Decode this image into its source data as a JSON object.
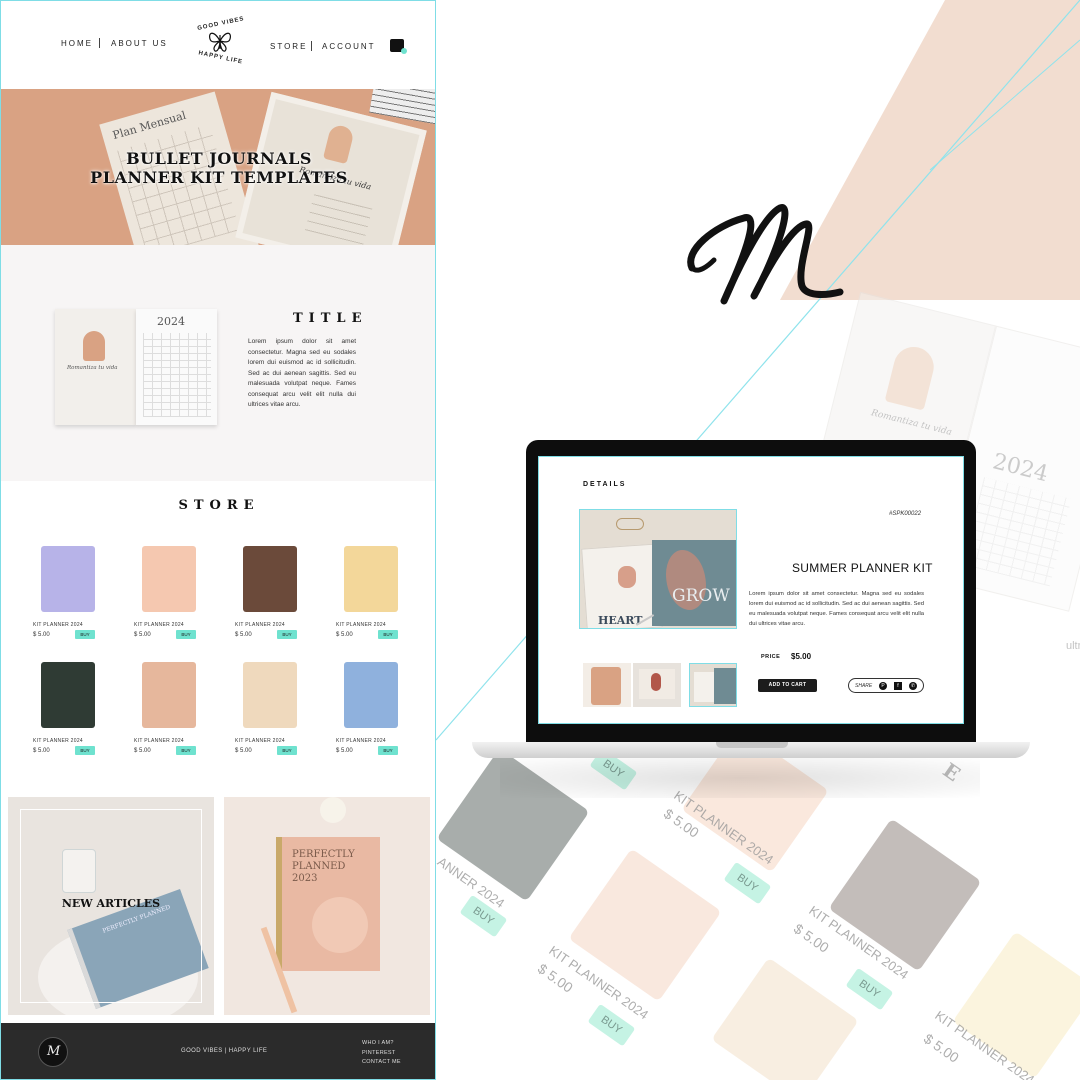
{
  "nav": {
    "home": "HOME",
    "about": "ABOUT US",
    "store": "STORE",
    "account": "ACCOUNT",
    "logo_top": "GOOD VIBES",
    "logo_bottom": "HAPPY LIFE"
  },
  "hero": {
    "line1": "BULLET JOURNALS",
    "line2": "PLANNER KIT TEMPLATES",
    "sheet_title": "Plan Mensual",
    "sheet_caption": "Romantiza tu vida"
  },
  "about": {
    "title": "TITLE",
    "body": "Lorem ipsum dolor sit amet consectetur. Magna sed eu sodales lorem dui euismod ac id sollicitudin. Sed ac dui aenean sagittis. Sed eu malesuada volutpat neque. Fames consequat arcu velit elit nulla dui ultrices vitae arcu.",
    "book_year": "2024",
    "book_caption": "Romantiza tu vida"
  },
  "store": {
    "title": "STORE",
    "products": [
      {
        "name": "KIT PLANNER 2024",
        "price": "$ 5.00",
        "buy": "BUY",
        "color": "#b7b3e8"
      },
      {
        "name": "KIT PLANNER 2024",
        "price": "$ 5.00",
        "buy": "BUY",
        "color": "#f5c8b0"
      },
      {
        "name": "KIT PLANNER 2024",
        "price": "$ 5.00",
        "buy": "BUY",
        "color": "#6b4a3a"
      },
      {
        "name": "KIT PLANNER 2024",
        "price": "$ 5.00",
        "buy": "BUY",
        "color": "#f3d79a"
      },
      {
        "name": "KIT PLANNER 2024",
        "price": "$ 5.00",
        "buy": "BUY",
        "color": "#2f3b34"
      },
      {
        "name": "KIT PLANNER 2024",
        "price": "$ 5.00",
        "buy": "BUY",
        "color": "#e6b79c"
      },
      {
        "name": "KIT PLANNER 2024",
        "price": "$ 5.00",
        "buy": "BUY",
        "color": "#efd9bd"
      },
      {
        "name": "KIT PLANNER 2024",
        "price": "$ 5.00",
        "buy": "BUY",
        "color": "#8fb1dd"
      }
    ]
  },
  "articles": {
    "title": "NEW ARTICLES",
    "book1_text": "PERFECTLY PLANNED",
    "book2_line1": "PERFECTLY",
    "book2_line2": "PLANNED",
    "book2_year": "2023"
  },
  "footer": {
    "brand": "GOOD VIBES | HAPPY LIFE",
    "links": [
      "WHO I AM?",
      "PINTEREST",
      "CONTACT ME"
    ]
  },
  "signature": "M",
  "details": {
    "heading": "DETAILS",
    "sku": "#SPK00022",
    "product_name": "SUMMER PLANNER KIT",
    "description": "Lorem ipsum dolor sit amet consectetur. Magna sed eu sodales lorem dui euismod ac id sollicitudin. Sed ac dui aenean sagittis. Sed eu malesuada volutpat neque. Fames consequat arcu velit elit nulla dui ultrices vitae arcu.",
    "price_label": "PRICE",
    "price": "$5.00",
    "add_to_cart": "ADD TO CART",
    "share": "SHARE",
    "img_word1": "GROW",
    "img_word2": "HEART"
  },
  "background_listing": {
    "items": [
      {
        "name": "KIT PLANNER 2024",
        "price": "$ 5.00",
        "buy": "BUY"
      },
      {
        "name": "KIT PLANNER 2024",
        "price": "$ 5.00",
        "buy": "BUY"
      },
      {
        "name": "KIT PLANNER 2024",
        "price": "$ 5.00",
        "buy": "BUY"
      },
      {
        "name": "KIT PLANNER 2024",
        "price": "$ 5.00",
        "buy": "BUY"
      }
    ],
    "partial_name": "ANNER 2024",
    "partial_letter": "E",
    "book_caption": "Romantiza tu vida",
    "book_year": "2024",
    "edge_text": "ultri"
  },
  "colors": {
    "accent": "#6fe2cf",
    "outline": "#7fdde6",
    "hero": "#d9a283",
    "footer": "#2b2b2b"
  }
}
